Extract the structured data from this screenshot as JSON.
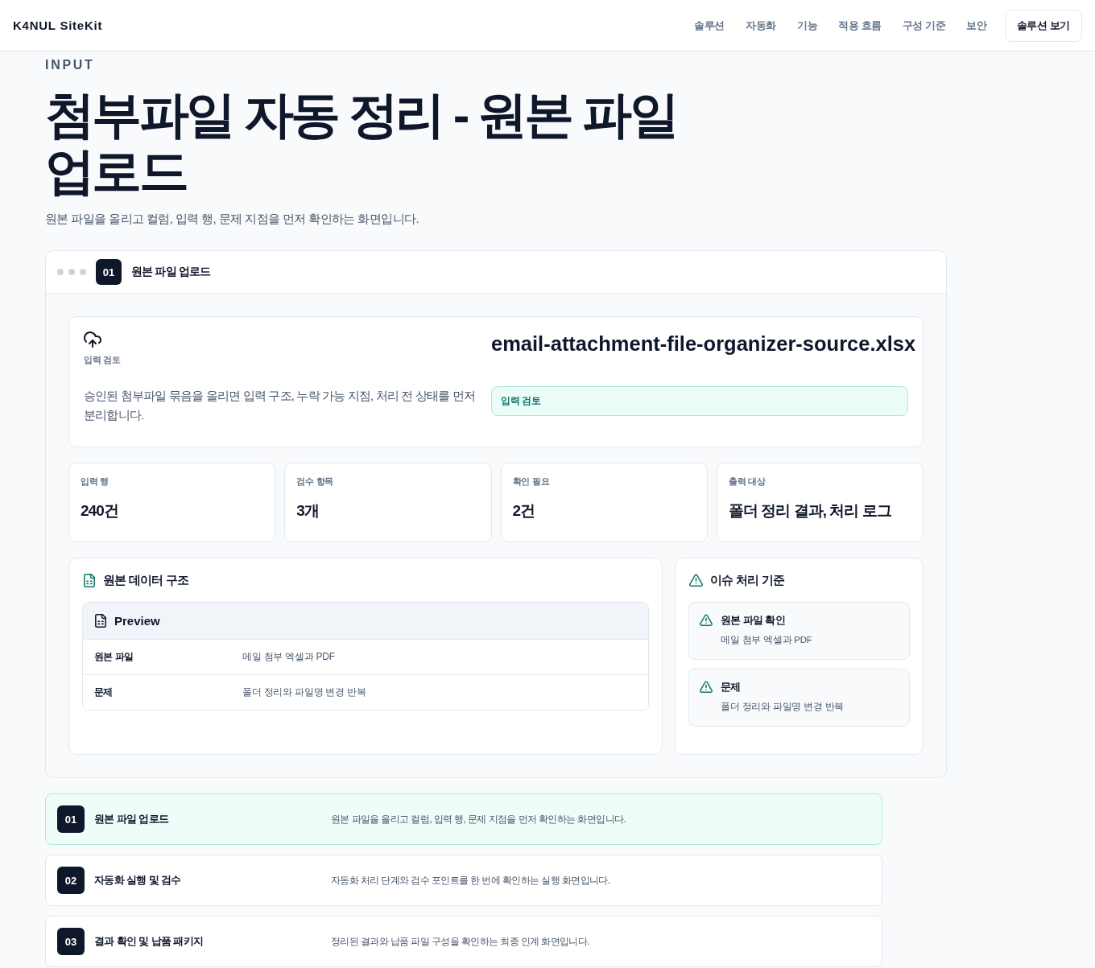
{
  "header": {
    "logo": "K4NUL SiteKit",
    "nav": [
      "솔루션",
      "자동화",
      "기능",
      "적용 흐름",
      "구성 기준",
      "보안"
    ],
    "cta": "솔루션 보기"
  },
  "hero": {
    "eyebrow": "INPUT",
    "title": "첨부파일 자동 정리 - 원본 파일 업로드",
    "subtitle": "원본 파일을 올리고 컬럼, 입력 행, 문제 지점을 먼저 확인하는 화면입니다."
  },
  "panel": {
    "step": "01",
    "title": "원본 파일 업로드",
    "upload": {
      "label": "입력 검토",
      "description": "승인된 첨부파일 묶음을 올리면 입력 구조, 누락 가능 지점, 처리 전 상태를 먼저 분리합니다.",
      "filename": "email-attachment-file-organizer-source.xlsx",
      "status": "입력 검토"
    },
    "stats": [
      {
        "label": "입력 행",
        "value": "240건"
      },
      {
        "label": "검수 항목",
        "value": "3개"
      },
      {
        "label": "확인 필요",
        "value": "2건"
      },
      {
        "label": "출력 대상",
        "value": "폴더 정리 결과, 처리 로그"
      }
    ],
    "structure": {
      "title": "원본 데이터 구조",
      "table_title": "Preview",
      "rows": [
        {
          "key": "원본 파일",
          "value": "메일 첨부 엑셀과 PDF"
        },
        {
          "key": "문제",
          "value": "폴더 정리와 파일명 변경 반복"
        }
      ]
    },
    "issues": {
      "title": "이슈 처리 기준",
      "items": [
        {
          "title": "원본 파일 확인",
          "description": "메일 첨부 엑셀과 PDF"
        },
        {
          "title": "문제",
          "description": "폴더 정리와 파일명 변경 반복"
        }
      ]
    }
  },
  "steps": [
    {
      "number": "01",
      "title": "원본 파일 업로드",
      "description": "원본 파일을 올리고 컬럼, 입력 행, 문제 지점을 먼저 확인하는 화면입니다.",
      "selected": true
    },
    {
      "number": "02",
      "title": "자동화 실행 및 검수",
      "description": "자동화 처리 단계와 검수 포인트를 한 번에 확인하는 실행 화면입니다.",
      "selected": false
    },
    {
      "number": "03",
      "title": "결과 확인 및 납품 패키지",
      "description": "정리된 결과와 납품 파일 구성을 확인하는 최종 인계 화면입니다.",
      "selected": false
    }
  ]
}
